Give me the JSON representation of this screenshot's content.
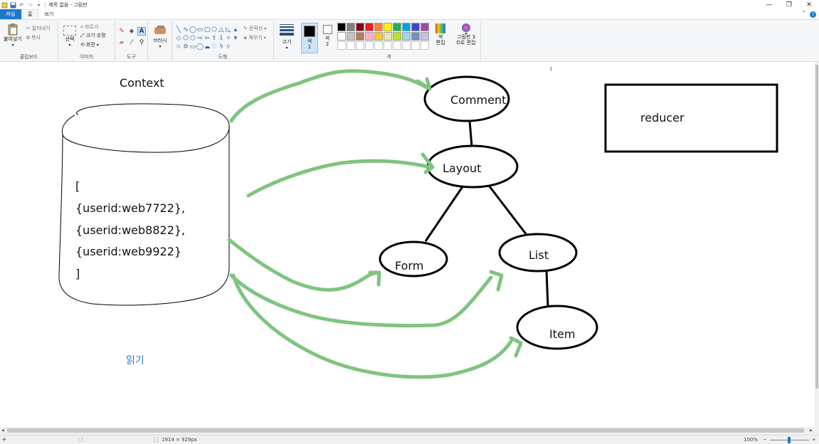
{
  "window": {
    "title": "제목 없음 - 그림판"
  },
  "tabs": {
    "file": "파일",
    "home": "홈",
    "view": "보기"
  },
  "ribbon": {
    "clipboard": {
      "label": "클립보드",
      "paste": "붙여넣기",
      "cut": "잘라내기",
      "copy": "복사"
    },
    "image": {
      "label": "이미지",
      "select": "선택",
      "crop": "자르기",
      "resize": "크기 조정",
      "rotate": "회전"
    },
    "tools": {
      "label": "도구"
    },
    "brush": "브러시",
    "shapes": {
      "label": "도형",
      "outline": "윤곽선",
      "fill": "채우기"
    },
    "size": "크기",
    "colors": {
      "label": "색",
      "color1": "색\n1",
      "color2": "색\n2",
      "color1_value": "#000000",
      "color2_value": "#ffffff",
      "edit": "색\n편집",
      "paint3d": "그림판 3\nD로 편집",
      "palette": [
        "#000000",
        "#7f7f7f",
        "#880015",
        "#ed1c24",
        "#ff7f27",
        "#fff200",
        "#22b14c",
        "#00a2e8",
        "#3f48cc",
        "#a349a4",
        "#ffffff",
        "#c3c3c3",
        "#b97a57",
        "#ffaec9",
        "#ffc90e",
        "#efe4b0",
        "#b5e61d",
        "#99d9ea",
        "#7092be",
        "#c8bfe7",
        "#ffffff",
        "#ffffff",
        "#ffffff",
        "#ffffff",
        "#ffffff",
        "#ffffff",
        "#ffffff",
        "#ffffff",
        "#ffffff",
        "#ffffff"
      ]
    }
  },
  "drawing": {
    "context_title": "Context",
    "array_lines": [
      "[",
      "{userid:web7722},",
      "{userid:web8822},",
      "{userid:web9922}",
      "]"
    ],
    "read_label": "읽기",
    "nodes": {
      "comment": "Comment",
      "layout": "Layout",
      "form": "Form",
      "list": "List",
      "item": "Item"
    },
    "reducer": "reducer",
    "arrow_color": "#7fc47f"
  },
  "status": {
    "dimensions": "1914 × 929px",
    "zoom": "100%"
  }
}
